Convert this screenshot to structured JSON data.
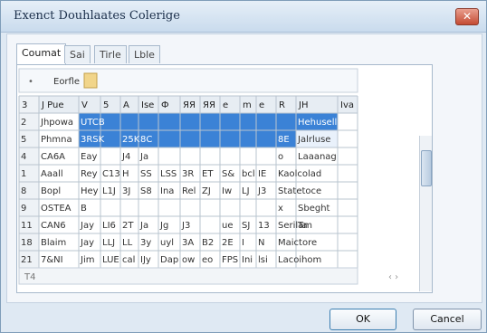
{
  "dialog": {
    "title": "Exenct Douhlaates Colerige",
    "close_glyph": "✕"
  },
  "tabs": [
    {
      "label": "Coumat",
      "active": true
    },
    {
      "label": "Sai",
      "active": false
    },
    {
      "label": "Tirle",
      "active": false
    },
    {
      "label": "Lble",
      "active": false
    }
  ],
  "toolbar": {
    "bullet": "•",
    "cell_label": "Eorfle"
  },
  "header_row": [
    "3",
    "J Pue",
    "V",
    "5",
    "A",
    "Ise",
    "Ф",
    "ЯЯ",
    "ЯЯ",
    "e",
    "m",
    "e",
    "R",
    "JH",
    "Iva"
  ],
  "rows": [
    [
      "2",
      "Jhpowa",
      "UTCB",
      "",
      "",
      "",
      "",
      "",
      "",
      "",
      "",
      "",
      "",
      "Hehusell",
      ""
    ],
    [
      "5",
      "Phmna",
      "3RSK",
      "",
      "25K",
      "8C",
      "",
      "",
      "",
      "",
      "",
      "",
      "8E",
      "Jalrluse",
      ""
    ],
    [
      "4",
      "CA6A",
      "Eay",
      "",
      "J4",
      "Ja",
      "",
      "",
      "",
      "",
      "",
      "",
      "o",
      "Laaanag",
      ""
    ],
    [
      "1",
      "Aaall",
      "Rey",
      "C13",
      "H",
      "SS",
      "LSS",
      "3R",
      "ET",
      "S&",
      "bcl",
      "IE",
      "Kaolcolad",
      "",
      ""
    ],
    [
      "8",
      "Bopl",
      "Hey",
      "L1J",
      "3J",
      "S8",
      "Ina",
      "Rel",
      "ZJ",
      "Iw",
      "LJ",
      "J3",
      "Statetoce",
      "",
      ""
    ],
    [
      "9",
      "OSTEA",
      "B",
      "",
      "",
      "",
      "",
      "",
      "",
      "",
      "",
      "",
      "x",
      "Sbeght",
      ""
    ],
    [
      "11",
      "CAN6",
      "Jay",
      "LI6",
      "2T",
      "Ja",
      "Jg",
      "J3",
      "",
      "ue",
      "SJ",
      "13",
      "Serilam",
      "Ta",
      ""
    ],
    [
      "18",
      "Blaim",
      "Jay",
      "LLJ",
      "LL",
      "3y",
      "uyl",
      "3A",
      "B2",
      "2E",
      "I",
      "N",
      "Maictore",
      "",
      ""
    ],
    [
      "21",
      "7&NI",
      "Jim",
      "LUE",
      "cal",
      "IJy",
      "Dap",
      "ow",
      "eo",
      "FPS",
      "Ini",
      "lsi",
      "Lacoihom",
      "",
      ""
    ]
  ],
  "footer": {
    "left_label": "T4",
    "nav_icons": "‹ ›"
  },
  "buttons": {
    "ok": "OK",
    "cancel": "Cancel"
  },
  "colors": {
    "selection": "#3b82d6",
    "selection_text": "#ffffff",
    "grid_line": "#b9c4cf"
  }
}
